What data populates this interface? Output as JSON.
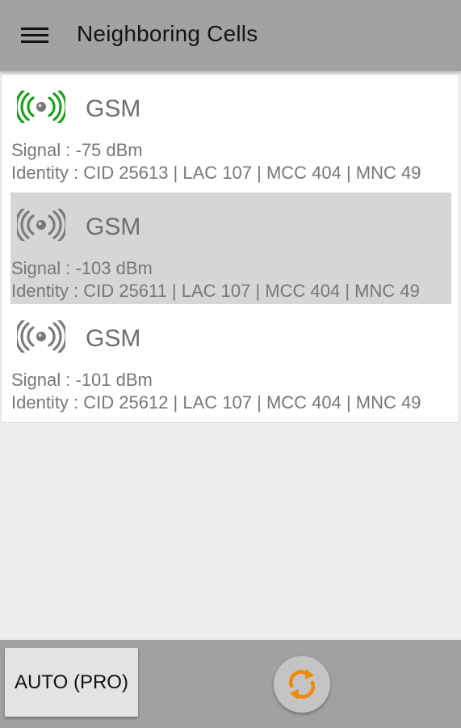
{
  "app_bar": {
    "title": "Neighboring Cells",
    "menu_icon": "menu-icon"
  },
  "cells": [
    {
      "type": "GSM",
      "signal": "Signal : -75 dBm",
      "identity": "Identity : CID 25613 | LAC 107 | MCC 404 | MNC 49",
      "icon": "signal-tower-icon",
      "icon_color": "#1a9e1a",
      "selected": false
    },
    {
      "type": "GSM",
      "signal": "Signal : -103 dBm",
      "identity": "Identity : CID 25611 | LAC 107 | MCC 404 | MNC 49",
      "icon": "signal-tower-icon",
      "icon_color": "#7a7a7a",
      "selected": true
    },
    {
      "type": "GSM",
      "signal": "Signal : -101 dBm",
      "identity": "Identity : CID 25612 | LAC 107 | MCC 404 | MNC 49",
      "icon": "signal-tower-icon",
      "icon_color": "#7a7a7a",
      "selected": false
    }
  ],
  "bottom_bar": {
    "auto_label": "AUTO (PRO)",
    "refresh_icon": "refresh-icon",
    "refresh_color": "#f08a00"
  },
  "colors": {
    "app_bar": "#a2a2a2",
    "background": "#eeeeee",
    "selected_row": "#d6d6d6",
    "active_signal": "#1a9e1a",
    "inactive_signal": "#7a7a7a",
    "accent": "#f08a00"
  }
}
